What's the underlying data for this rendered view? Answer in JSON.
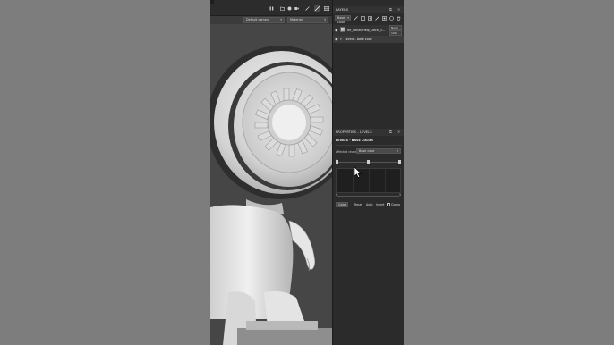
{
  "viewport": {
    "camera_select": "Default camera",
    "material_select": "Material"
  },
  "icons": {
    "toolbar": [
      "pause-icon",
      "folder-icon",
      "camera-icon",
      "video-icon",
      "brush-icon",
      "paint-icon",
      "grid-icon"
    ],
    "layers_tools": [
      "brush-icon",
      "fill-icon",
      "add-icon",
      "add-folder-icon",
      "mask-icon",
      "effect-icon",
      "delete-icon"
    ]
  },
  "layers": {
    "title": "LAYERS",
    "channel_select": "Base color",
    "items": [
      {
        "name": "dir_handleHelp_Decal_c...",
        "blend": "Norm",
        "opacity": "100"
      },
      {
        "name": "Levels - Base color"
      }
    ]
  },
  "properties": {
    "title": "PROPERTIES - LEVELS",
    "subtitle": "LEVELS - BASE COLOR",
    "affected_label": "Affected channel:",
    "affected_value": "Base color",
    "left_value": "0",
    "right_value": "1",
    "color_select": "Color",
    "buttons": [
      "Reset",
      "Auto",
      "Invert"
    ],
    "clamp_label": "Clamp",
    "histogram": {
      "input_black": 0,
      "gamma": 0.5,
      "input_white": 1
    }
  },
  "colors": {
    "app_bg": "#2a2a2a",
    "panel_bg": "#2b2b2b",
    "viewport_bg": "#464646",
    "page_bg": "#7d7d7d"
  }
}
